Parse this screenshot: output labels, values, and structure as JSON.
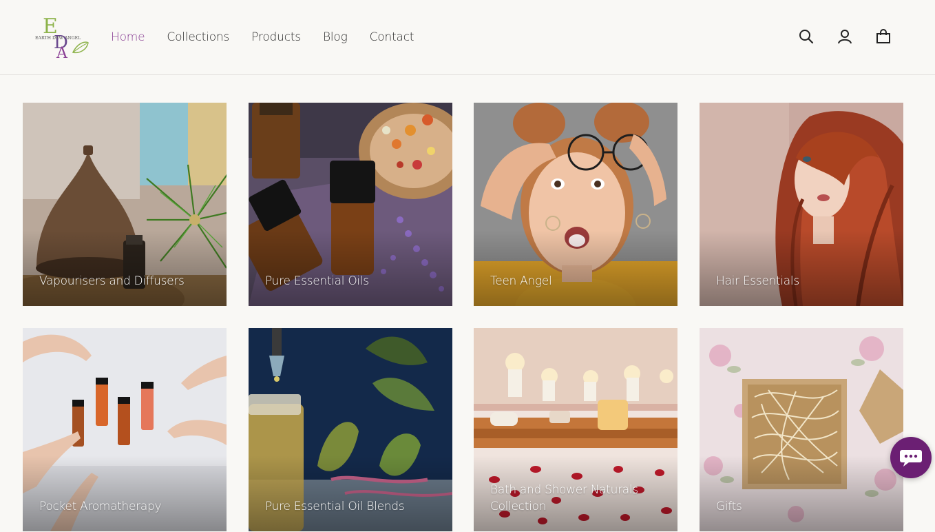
{
  "brand": {
    "logo_text": "EARTH DEW ANGEL",
    "logo_letters": "EDA",
    "accent": "#8a3f94",
    "leaf": "#8db34a"
  },
  "nav": {
    "items": [
      {
        "label": "Home",
        "active": true
      },
      {
        "label": "Collections",
        "active": false
      },
      {
        "label": "Products",
        "active": false
      },
      {
        "label": "Blog",
        "active": false
      },
      {
        "label": "Contact",
        "active": false
      }
    ]
  },
  "header_icons": [
    "search-icon",
    "account-icon",
    "cart-icon"
  ],
  "collections": [
    {
      "label": "Vapourisers and Diffusers"
    },
    {
      "label": "Pure Essential Oils"
    },
    {
      "label": "Teen Angel"
    },
    {
      "label": "Hair Essentials"
    },
    {
      "label": "Pocket Aromatherapy"
    },
    {
      "label": "Pure Essential Oil Blends"
    },
    {
      "label": "Bath and Shower Naturals Collection"
    },
    {
      "label": "Gifts"
    }
  ],
  "chat": {
    "icon": "chat-bubble-icon",
    "color": "#6b1f73"
  }
}
